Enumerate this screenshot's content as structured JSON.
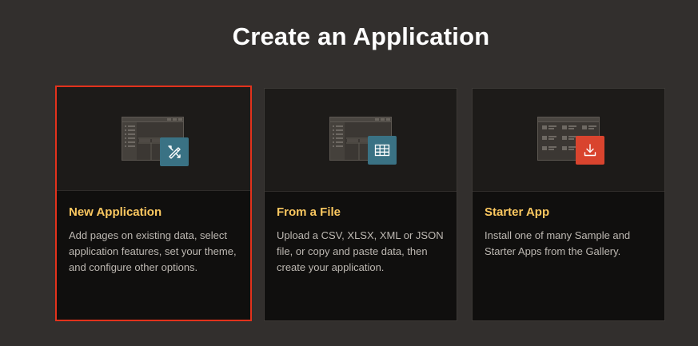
{
  "page": {
    "title": "Create an Application"
  },
  "cards": [
    {
      "id": "new-application",
      "title": "New Application",
      "description": "Add pages on existing data, select application features, set your theme, and configure other options.",
      "icon": "wizard-pencil-ruler-icon",
      "badge_color": "#3a7284",
      "selected": true
    },
    {
      "id": "from-a-file",
      "title": "From a File",
      "description": "Upload a CSV, XLSX, XML or JSON file, or copy and paste data, then create your application.",
      "icon": "table-grid-icon",
      "badge_color": "#3a7284",
      "selected": false
    },
    {
      "id": "starter-app",
      "title": "Starter App",
      "description": "Install one of many Sample and Starter Apps from the Gallery.",
      "icon": "download-icon",
      "badge_color": "#d9442e",
      "selected": false
    }
  ],
  "colors": {
    "background": "#322f2d",
    "card": "#100f0e",
    "card_header": "#1d1b19",
    "title_accent": "#fbc860",
    "selection_border": "#e2321c"
  }
}
